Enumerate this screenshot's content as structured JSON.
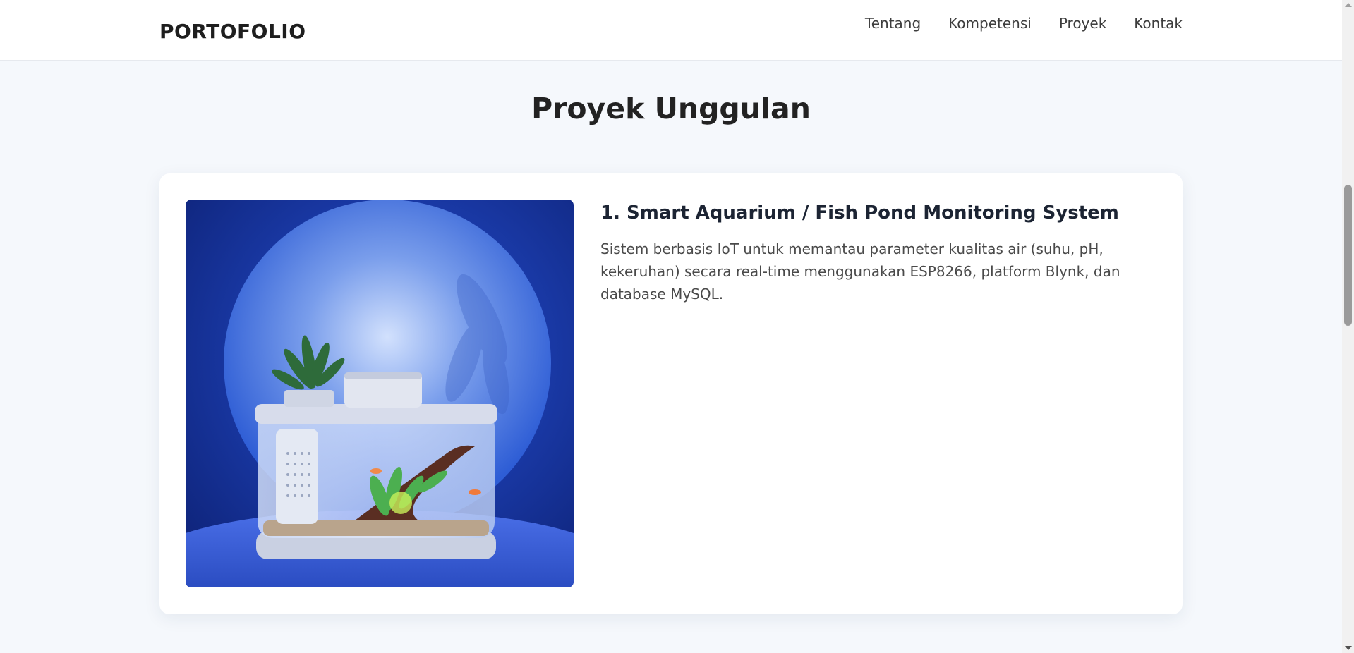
{
  "header": {
    "logo": "PORTOFOLIO",
    "nav": [
      "Tentang",
      "Kompetensi",
      "Proyek",
      "Kontak"
    ]
  },
  "section": {
    "title": "Proyek Unggulan"
  },
  "projects": [
    {
      "title": "1. Smart Aquarium / Fish Pond Monitoring System",
      "description": "Sistem berbasis IoT untuk memantau parameter kualitas air (suhu, pH, kekeruhan) secara real-time menggunakan ESP8266, platform Blynk, dan database MySQL.",
      "image_icon": "aquarium-photo"
    }
  ],
  "colors": {
    "page_bg": "#f5f8fc",
    "header_bg": "#ffffff",
    "card_bg": "#ffffff",
    "image_blue": "#1a3aa8"
  }
}
